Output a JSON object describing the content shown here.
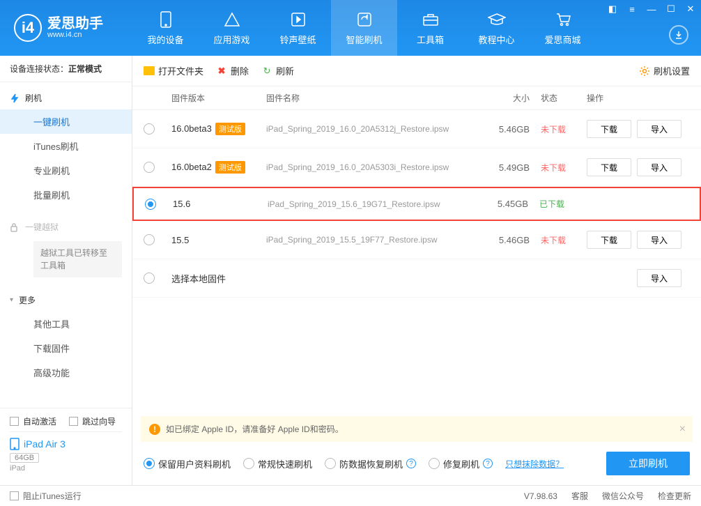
{
  "app": {
    "title": "爱思助手",
    "url": "www.i4.cn"
  },
  "topTabs": [
    {
      "label": "我的设备"
    },
    {
      "label": "应用游戏"
    },
    {
      "label": "铃声壁纸"
    },
    {
      "label": "智能刷机"
    },
    {
      "label": "工具箱"
    },
    {
      "label": "教程中心"
    },
    {
      "label": "爱思商城"
    }
  ],
  "status": {
    "label": "设备连接状态：",
    "value": "正常模式"
  },
  "sidebar": {
    "flash": {
      "title": "刷机",
      "items": [
        "一键刷机",
        "iTunes刷机",
        "专业刷机",
        "批量刷机"
      ]
    },
    "jailbreak": {
      "title": "一键越狱",
      "note": "越狱工具已转移至工具箱"
    },
    "more": {
      "title": "更多",
      "items": [
        "其他工具",
        "下载固件",
        "高级功能"
      ]
    }
  },
  "bottomChecks": {
    "autoActivate": "自动激活",
    "skipGuide": "跳过向导"
  },
  "device": {
    "name": "iPad Air 3",
    "capacity": "64GB",
    "type": "iPad"
  },
  "toolbar": {
    "open": "打开文件夹",
    "del": "删除",
    "refresh": "刷新",
    "settings": "刷机设置"
  },
  "columns": {
    "version": "固件版本",
    "name": "固件名称",
    "size": "大小",
    "status": "状态",
    "ops": "操作"
  },
  "rows": [
    {
      "version": "16.0beta3",
      "beta": "测试版",
      "name": "iPad_Spring_2019_16.0_20A5312j_Restore.ipsw",
      "size": "5.46GB",
      "status": "未下载",
      "downloaded": false,
      "selected": false
    },
    {
      "version": "16.0beta2",
      "beta": "测试版",
      "name": "iPad_Spring_2019_16.0_20A5303i_Restore.ipsw",
      "size": "5.49GB",
      "status": "未下载",
      "downloaded": false,
      "selected": false
    },
    {
      "version": "15.6",
      "beta": "",
      "name": "iPad_Spring_2019_15.6_19G71_Restore.ipsw",
      "size": "5.45GB",
      "status": "已下载",
      "downloaded": true,
      "selected": true
    },
    {
      "version": "15.5",
      "beta": "",
      "name": "iPad_Spring_2019_15.5_19F77_Restore.ipsw",
      "size": "5.46GB",
      "status": "未下载",
      "downloaded": false,
      "selected": false
    }
  ],
  "localRow": {
    "label": "选择本地固件"
  },
  "ops": {
    "download": "下载",
    "import": "导入"
  },
  "warning": "如已绑定 Apple ID，请准备好 Apple ID和密码。",
  "flashOptions": {
    "keepData": "保留用户资料刷机",
    "normal": "常规快速刷机",
    "antiRecovery": "防数据恢复刷机",
    "repair": "修复刷机",
    "eraseLink": "只想抹除数据？",
    "button": "立即刷机"
  },
  "footer": {
    "blockItunes": "阻止iTunes运行",
    "version": "V7.98.63",
    "service": "客服",
    "wechat": "微信公众号",
    "update": "检查更新"
  }
}
